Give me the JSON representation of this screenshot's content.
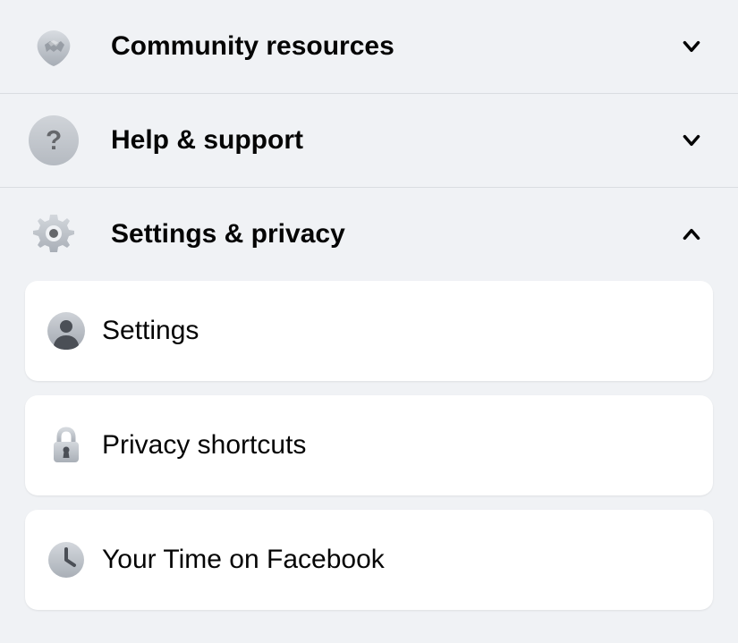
{
  "menu": [
    {
      "id": "community",
      "label": "Community resources",
      "icon": "handshake-icon",
      "expanded": false
    },
    {
      "id": "help",
      "label": "Help & support",
      "icon": "question-icon",
      "expanded": false
    },
    {
      "id": "settings-privacy",
      "label": "Settings & privacy",
      "icon": "gear-icon",
      "expanded": true,
      "subitems": [
        {
          "id": "settings",
          "label": "Settings",
          "icon": "person-circle-icon"
        },
        {
          "id": "privacy-shortcuts",
          "label": "Privacy shortcuts",
          "icon": "lock-icon"
        },
        {
          "id": "your-time",
          "label": "Your Time on Facebook",
          "icon": "clock-icon"
        }
      ]
    }
  ]
}
